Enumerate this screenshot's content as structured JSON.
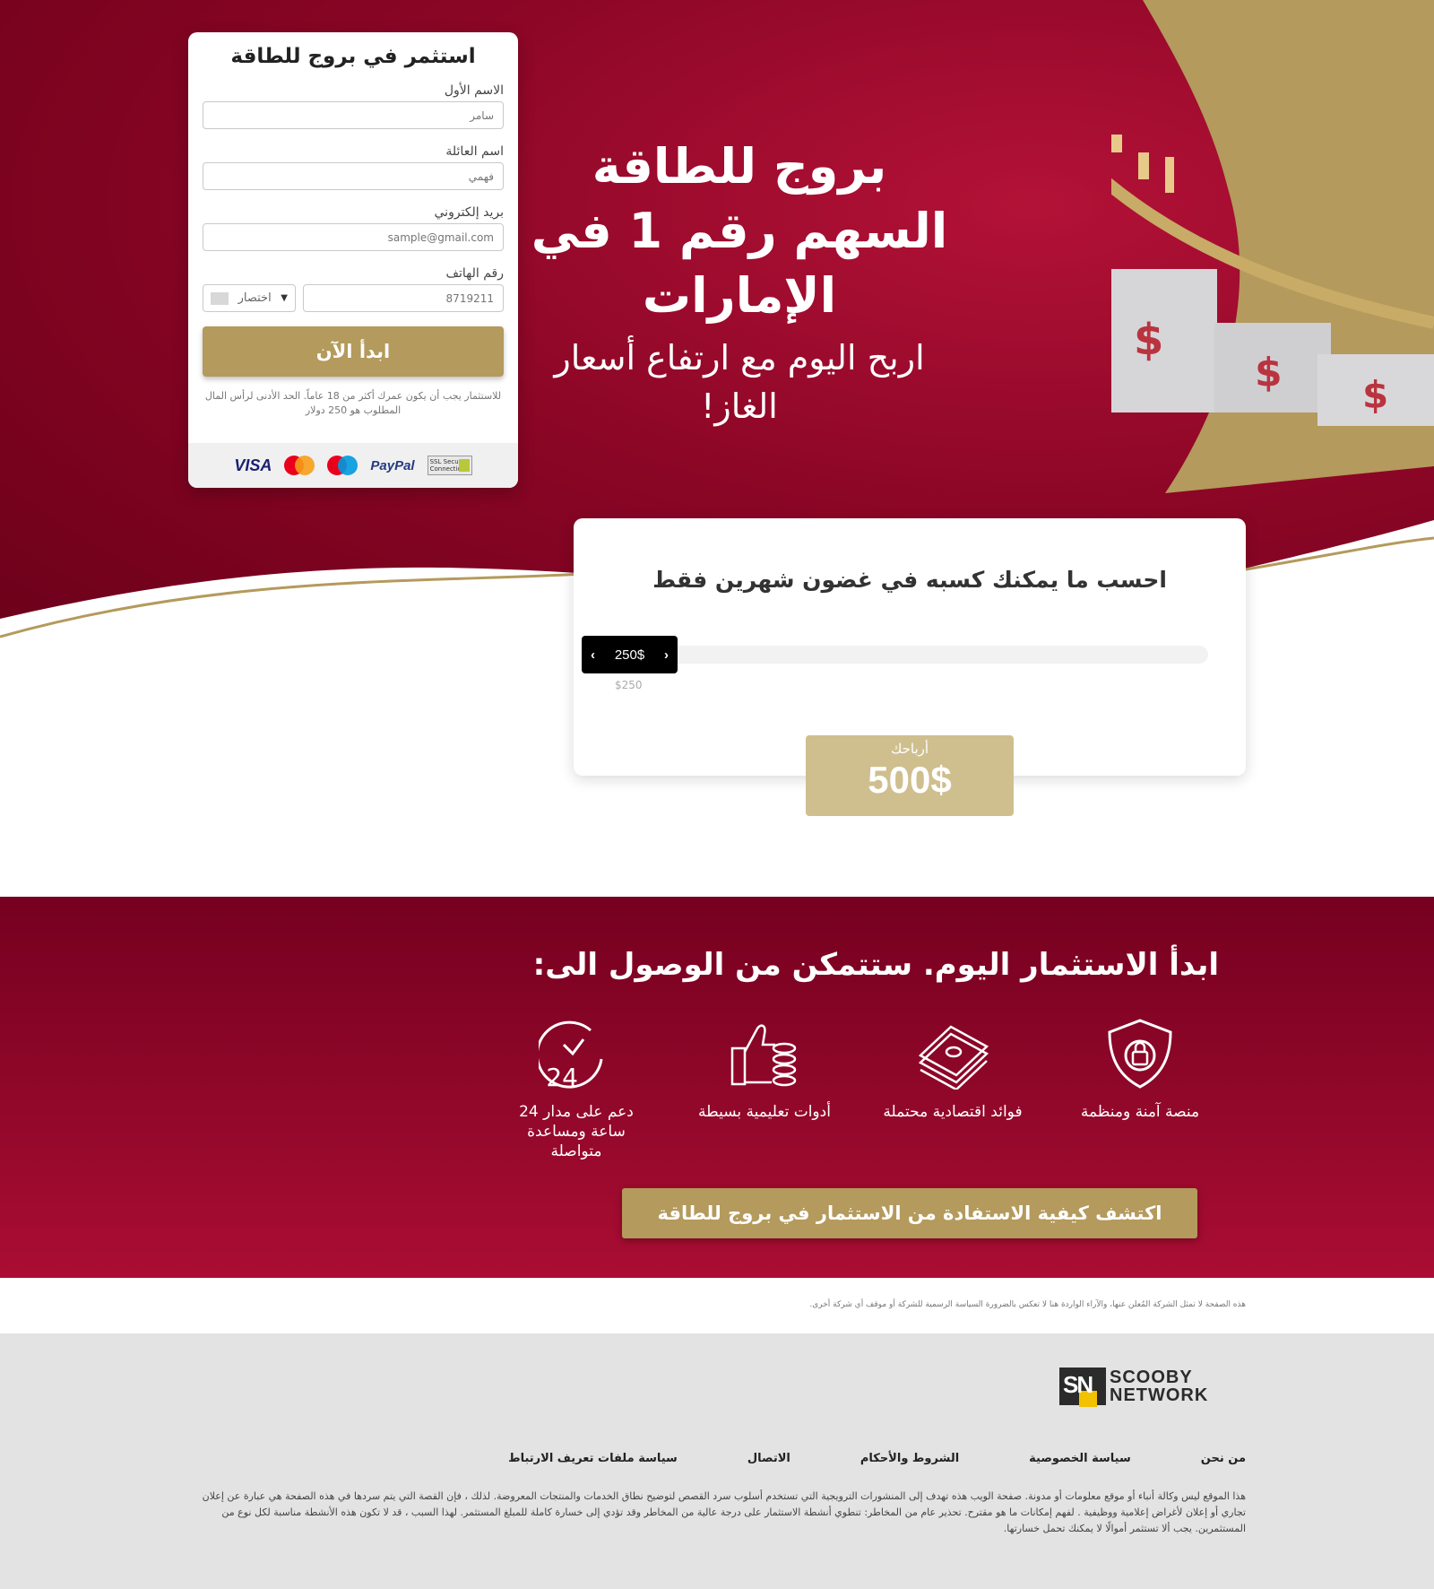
{
  "form": {
    "title": "استثمر في بروج للطاقة",
    "first_name_label": "الاسم الأول",
    "first_name_placeholder": "سامر",
    "last_name_label": "اسم العائلة",
    "last_name_placeholder": "فهمي",
    "email_label": "بريد إلكتروني",
    "email_placeholder": "sample@gmail.com",
    "phone_label": "رقم الهاتف",
    "phone_placeholder": "8719211",
    "country_code_label": "اختصار",
    "submit_label": "ابدأ الآن",
    "disclaimer": "للاستثمار يجب أن يكون عمرك أكثر من 18 عاماً. الحد الأدنى لرأس المال المطلوب هو 250 دولار",
    "payment_icons": [
      "visa-logo",
      "mastercard-logo",
      "maestro-logo",
      "paypal-logo",
      "ssl-secure-badge"
    ],
    "visa_text": "VISA",
    "paypal_text": "PayPal",
    "ssl_text": "SSL Secure Connection"
  },
  "hero": {
    "headline": "بروج للطاقة السهم رقم 1 في الإمارات",
    "subheadline": "اربح اليوم مع ارتفاع أسعار الغاز!"
  },
  "calculator": {
    "title": "احسب ما يمكنك كسبه في غضون شهرين فقط",
    "slider_value": "250$",
    "slider_min_label": "$250",
    "slider_fraction": 0,
    "profit_label": "أرباحك",
    "profit_value": "500$"
  },
  "benefits": {
    "title": "ابدأ الاستثمار اليوم. ستتمكن من الوصول الى:",
    "items": [
      {
        "icon": "shield-lock-icon",
        "label": "منصة آمنة ومنظمة"
      },
      {
        "icon": "money-stack-icon",
        "label": "فوائد اقتصادية محتملة"
      },
      {
        "icon": "thumbs-up-coins-icon",
        "label": "أدوات تعليمية بسيطة"
      },
      {
        "icon": "clock-24-icon",
        "label": "دعم على مدار 24 ساعة ومساعدة متواصلة"
      }
    ],
    "cta_label": "اكتشف كيفية الاستفادة من الاستثمار في بروج للطاقة"
  },
  "note": "هذه الصفحة لا تمثل الشركة المُعلن عنها، والآراء الواردة هنا لا تعكس بالضرورة السياسة الرسمية للشركة أو موقف أي شركة أخرى.",
  "footer": {
    "logo_mark": "SN",
    "logo_line1": "SCOOBY",
    "logo_line2": "NETWORK",
    "links": [
      "من نحن",
      "سياسة الخصوصية",
      "الشروط والأحكام",
      "الاتصال",
      "سياسة ملفات تعريف الارتباط"
    ],
    "disclaimer": "هذا الموقع ليس وكالة أنباء أو موقع معلومات أو مدونة. صفحة الويب هذه تهدف إلى المنشورات الترويجية التي تستخدم أسلوب سرد القصص لتوضيح نطاق الخدمات والمنتجات المعروضة. لذلك ، فإن القصة التي يتم سردها في هذه الصفحة هي عبارة عن إعلان تجاري أو إعلان لأغراض إعلامية ووظيفية . لفهم إمكانات ما هو مقترح. تحذير عام من المخاطر: تنطوي أنشطة الاستثمار على درجة عالية من المخاطر وقد تؤدي إلى خسارة كاملة للمبلغ المستثمر. لهذا السبب ، قد لا تكون هذه الأنشطة مناسبة لكل نوع من المستثمرين. يجب ألا تستثمر أموالًا لا يمكنك تحمل خسارتها."
  },
  "colors": {
    "maroon": "#8c0626",
    "gold": "#b49a5c",
    "light_gold": "#cfbf8e"
  }
}
